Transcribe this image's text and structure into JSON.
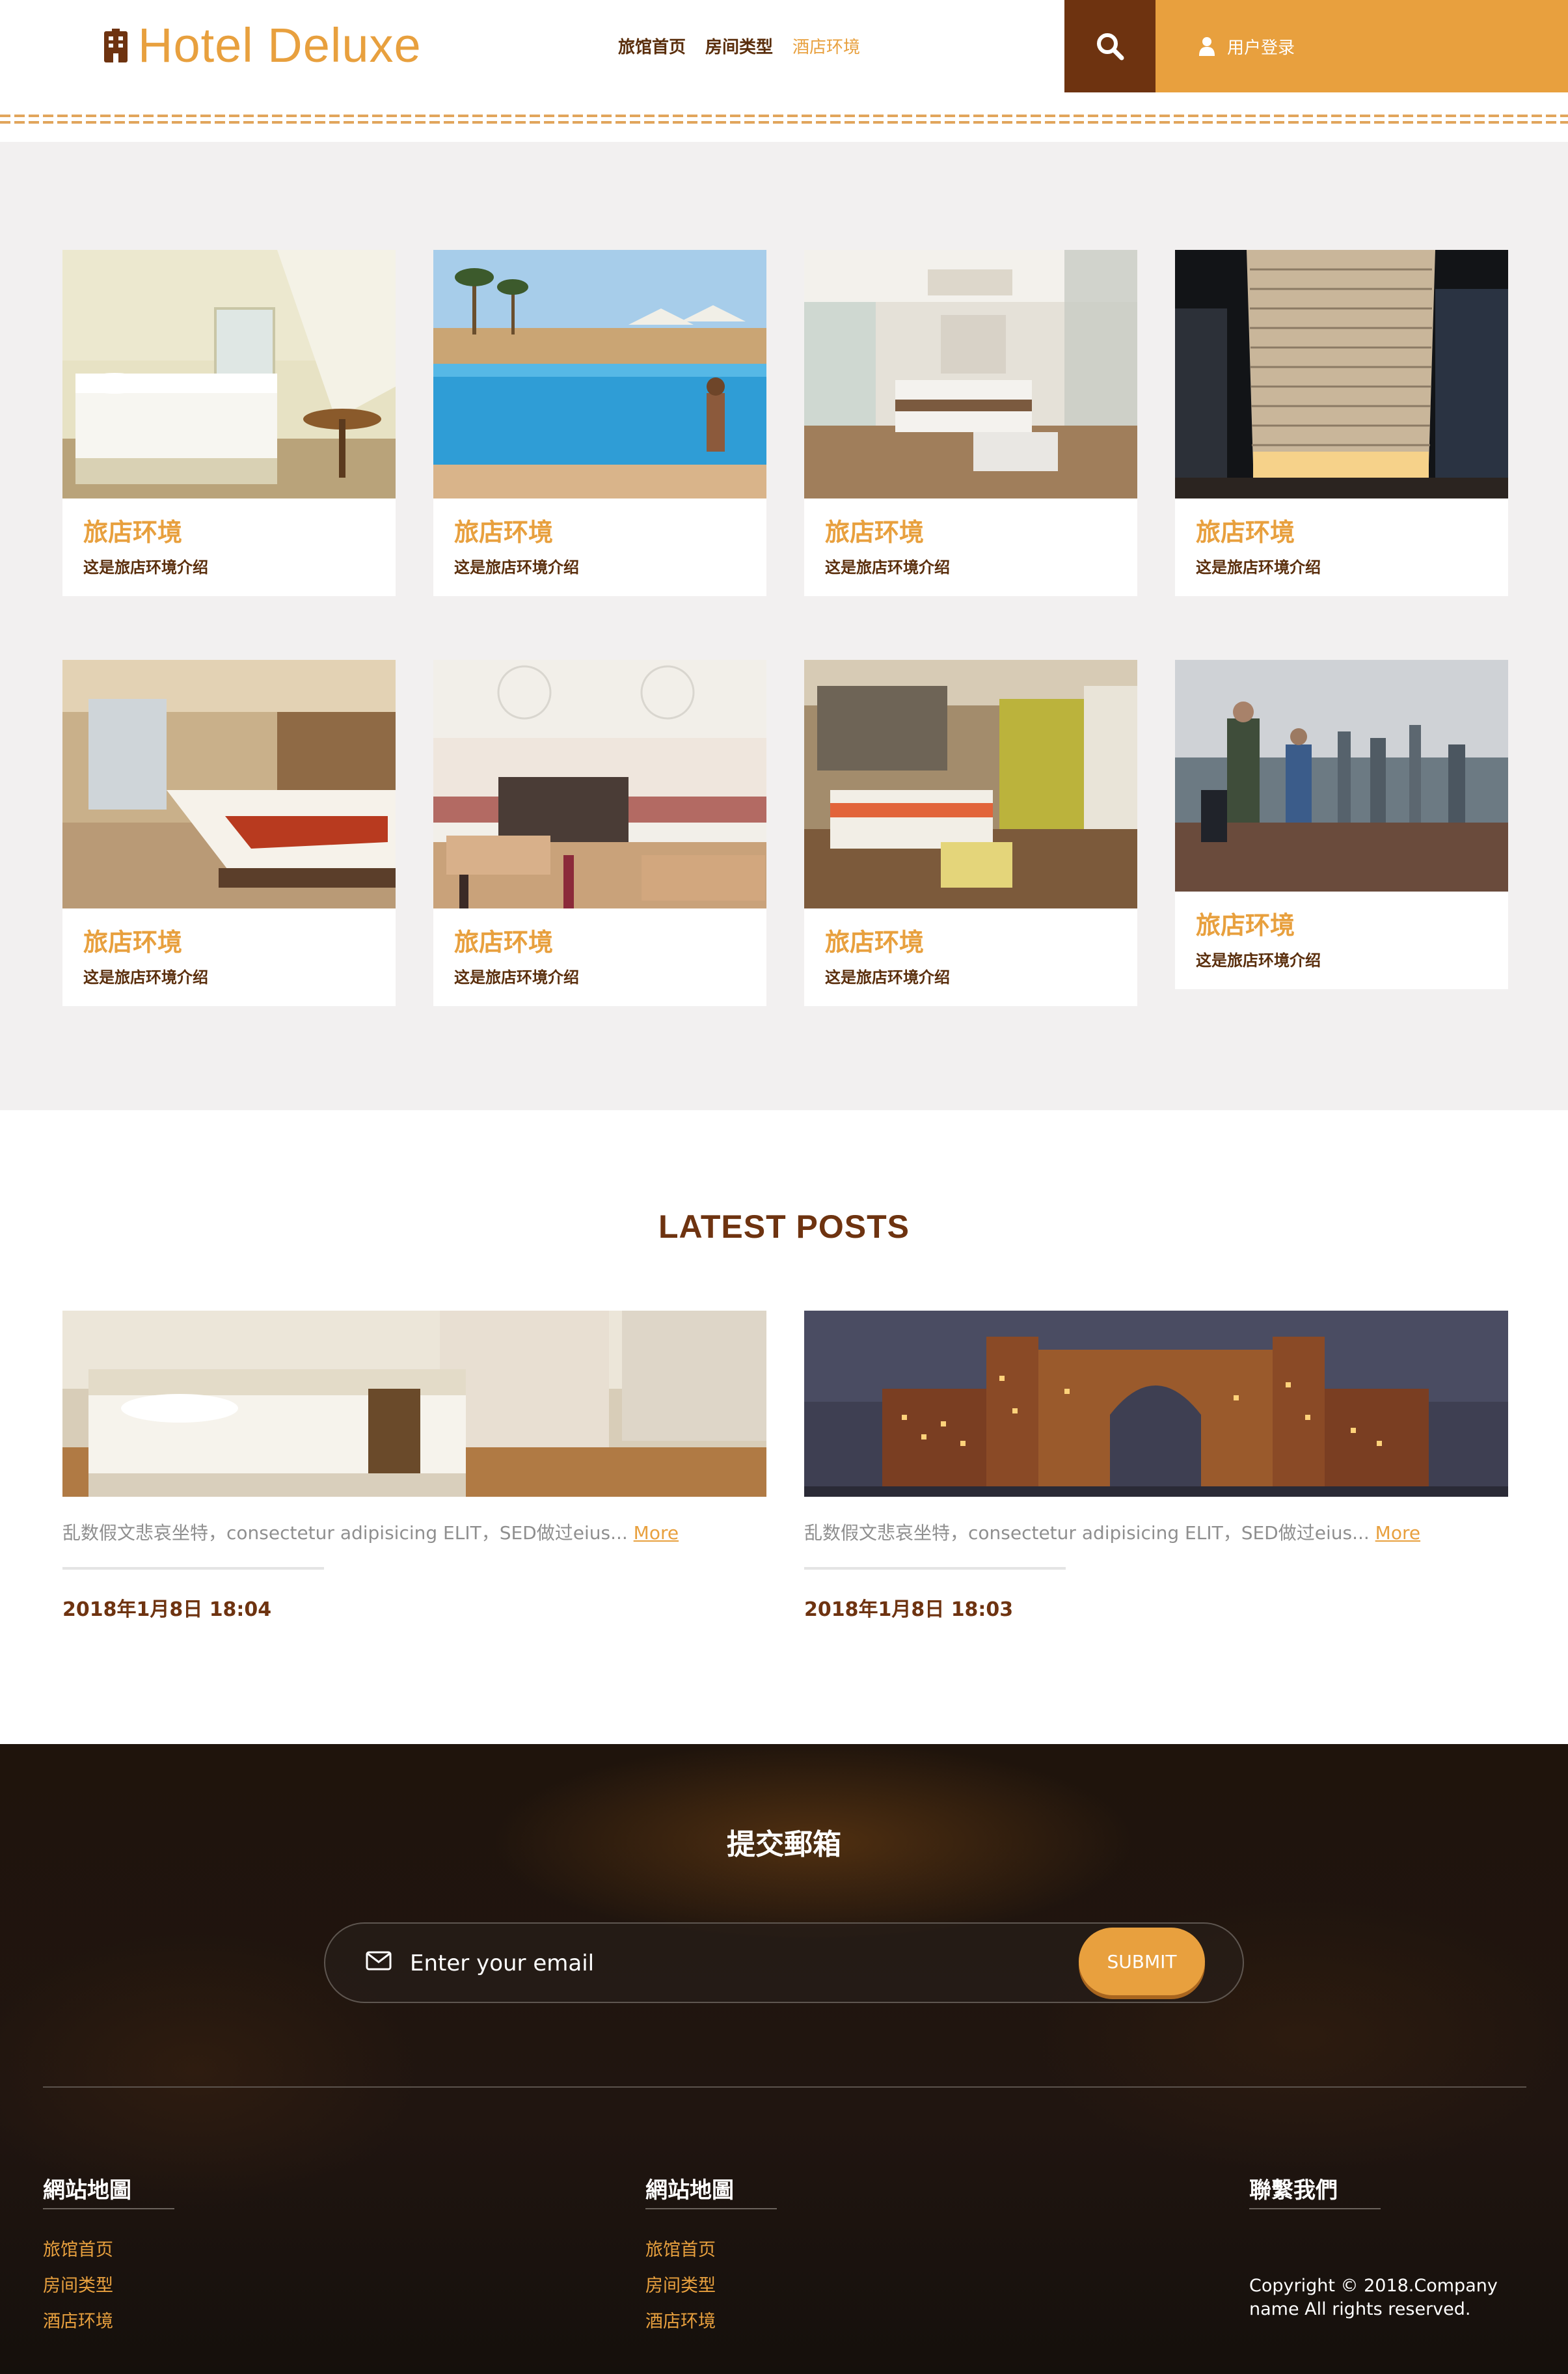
{
  "header": {
    "logo_text": "Hotel Deluxe",
    "nav": [
      {
        "label": "旅馆首页",
        "active": false
      },
      {
        "label": "房间类型",
        "active": false
      },
      {
        "label": "酒店环境",
        "active": true
      }
    ],
    "login_label": "用户登录"
  },
  "gallery": {
    "cards": [
      {
        "title": "旅店环境",
        "subtitle": "这是旅店环境介绍"
      },
      {
        "title": "旅店环境",
        "subtitle": "这是旅店环境介绍"
      },
      {
        "title": "旅店环境",
        "subtitle": "这是旅店环境介绍"
      },
      {
        "title": "旅店环境",
        "subtitle": "这是旅店环境介绍"
      },
      {
        "title": "旅店环境",
        "subtitle": "这是旅店环境介绍"
      },
      {
        "title": "旅店环境",
        "subtitle": "这是旅店环境介绍"
      },
      {
        "title": "旅店环境",
        "subtitle": "这是旅店环境介绍"
      },
      {
        "title": "旅店环境",
        "subtitle": "这是旅店环境介绍"
      }
    ]
  },
  "posts": {
    "title": "LATEST POSTS",
    "items": [
      {
        "excerpt": "乱数假文悲哀坐特，consectetur adipisicing ELIT，SED做过eius... ",
        "more": "More",
        "date": "2018年1月8日 18:04"
      },
      {
        "excerpt": "乱数假文悲哀坐特，consectetur adipisicing ELIT，SED做过eius... ",
        "more": "More",
        "date": "2018年1月8日 18:03"
      }
    ]
  },
  "footer": {
    "subscribe_title": "提交郵箱",
    "email_placeholder": "Enter your email",
    "submit_label": "SUBMIT",
    "columns": [
      {
        "heading": "網站地圖",
        "links": [
          "旅馆首页",
          "房间类型",
          "酒店环境"
        ]
      },
      {
        "heading": "網站地圖",
        "links": [
          "旅馆首页",
          "房间类型",
          "酒店环境"
        ]
      },
      {
        "heading": "聯繫我們",
        "copyright_line1": "Copyright © 2018.Company",
        "copyright_line2": "name All rights reserved."
      }
    ]
  },
  "colors": {
    "accent": "#e8a03e",
    "brown": "#6e3310",
    "gallery_bg": "#f2f0f0"
  },
  "icons": [
    "hotel-logo-icon",
    "search-icon",
    "user-icon",
    "mail-icon"
  ]
}
